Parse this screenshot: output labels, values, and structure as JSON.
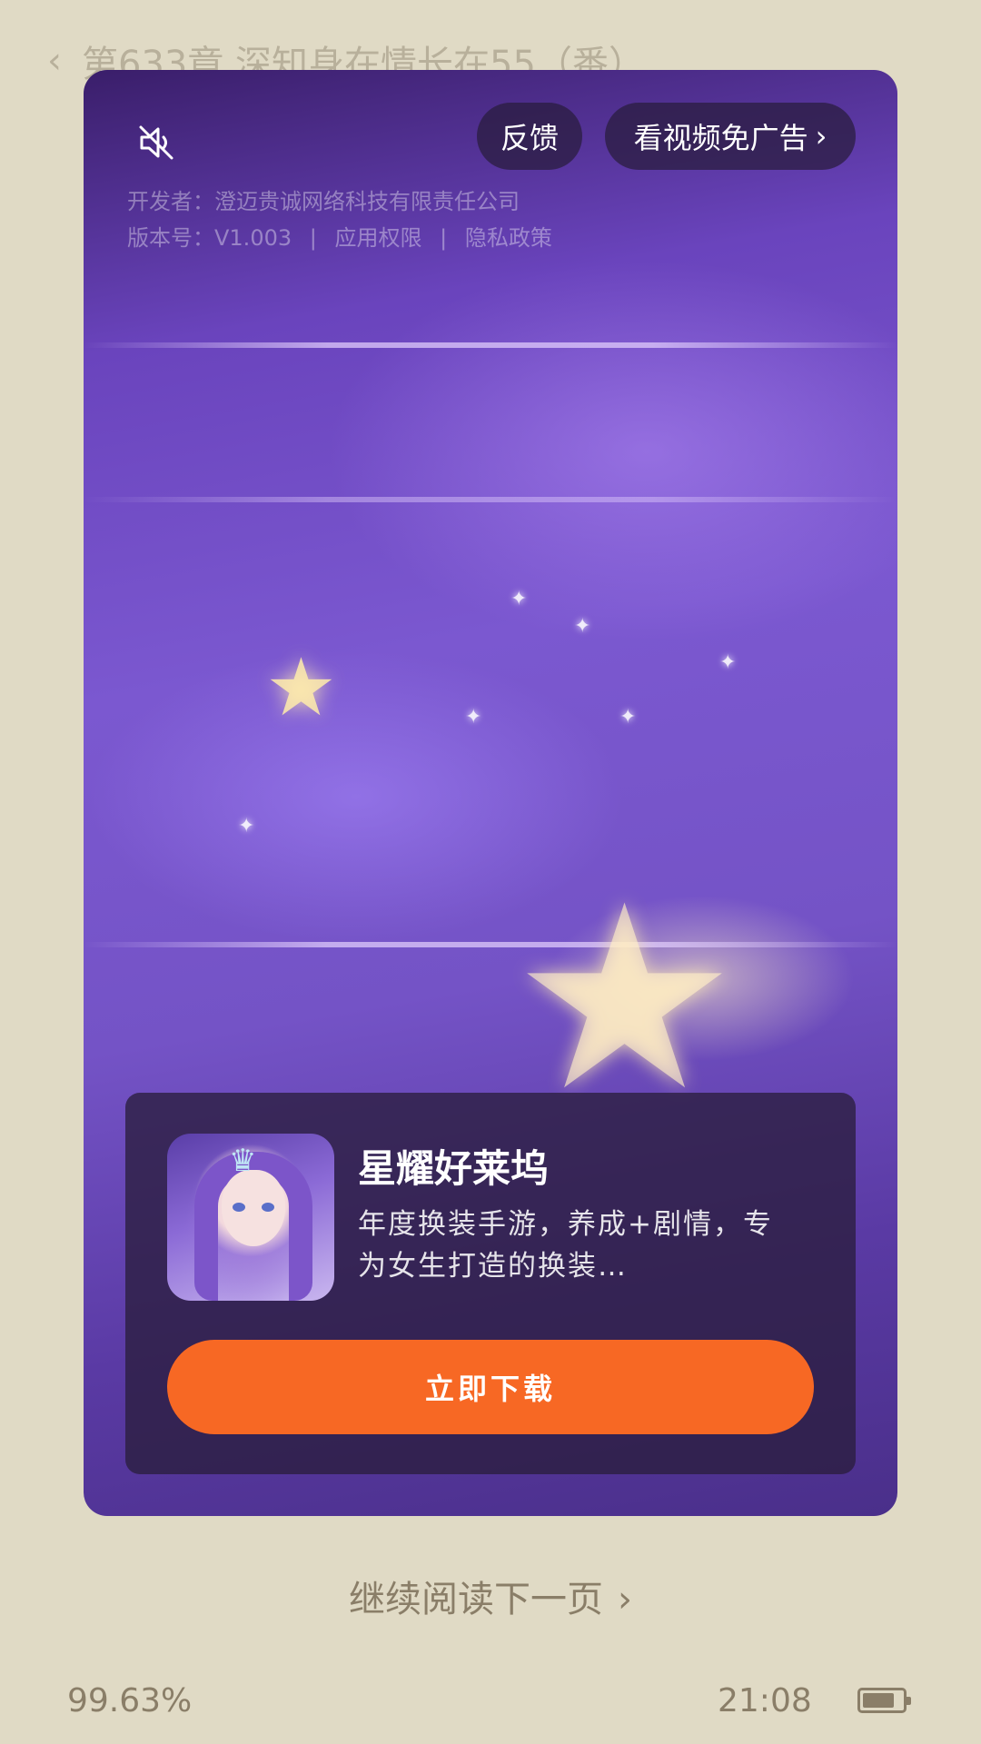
{
  "reader": {
    "back_icon": "chevron-left-icon",
    "chapter_title": "第633章 深知身在情长在55（番）"
  },
  "ad": {
    "mute_icon": "muted-speaker-icon",
    "feedback_label": "反馈",
    "skip_label": "看视频免广告",
    "skip_icon": "chevron-right-icon",
    "developer_line": "开发者：澄迈贵诚网络科技有限责任公司",
    "version": "版本号：V1.003",
    "permissions": "应用权限",
    "privacy": "隐私政策",
    "separator": "|",
    "app": {
      "name": "星耀好莱坞",
      "description": "年度换装手游，养成+剧情，专为女生打造的换装…",
      "download_label": "立即下载",
      "brand_color": "#f76824"
    }
  },
  "footer": {
    "next_page_label": "继续阅读下一页",
    "next_page_icon": "chevron-right-icon",
    "progress": "99.63%",
    "time": "21:08",
    "battery_level": 0.8
  }
}
